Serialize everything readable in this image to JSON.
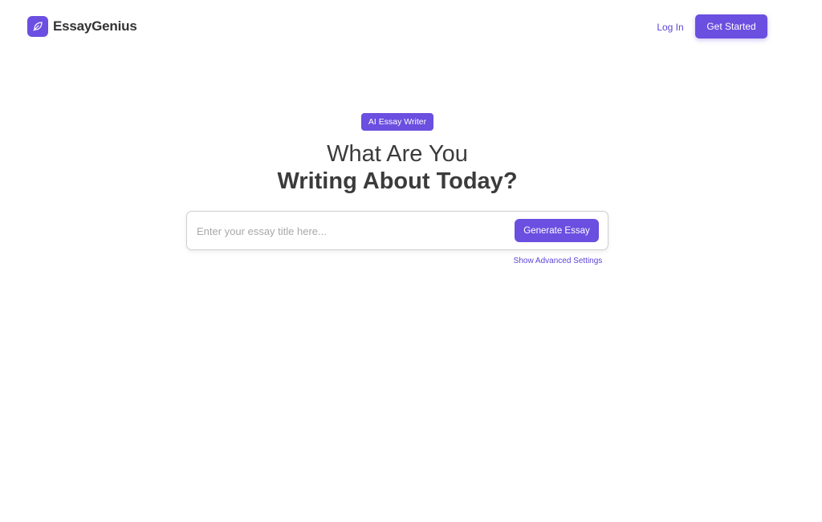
{
  "brand": {
    "name": "EssayGenius",
    "logo_icon": "feather-icon",
    "color": "#6a4fe0"
  },
  "nav": {
    "login_label": "Log In",
    "cta_label": "Get Started"
  },
  "hero": {
    "badge": "AI Essay Writer",
    "line1": "What Are You",
    "line2": "Writing About Today?"
  },
  "search": {
    "placeholder": "Enter your essay title here...",
    "value": "",
    "button_label": "Generate Essay",
    "advanced_link": "Show Advanced Settings"
  },
  "colors": {
    "accent": "#6a4fe0",
    "link": "#5b45d6",
    "text": "#3b3b3b"
  }
}
